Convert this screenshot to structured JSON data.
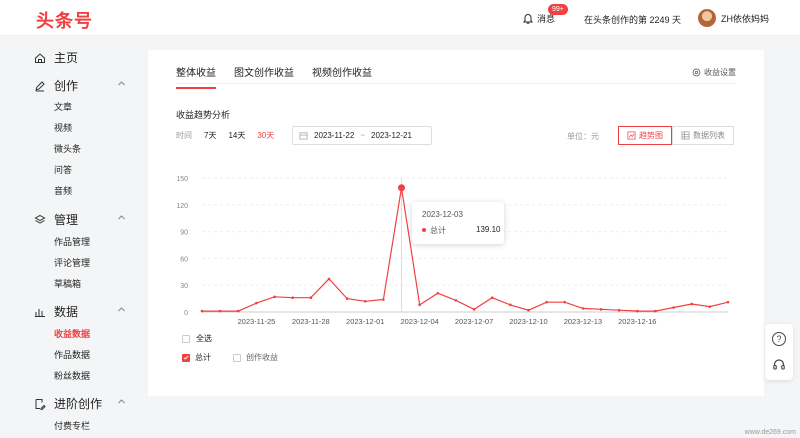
{
  "header": {
    "logo": "头条号",
    "messages_label": "消息",
    "messages_badge": "99+",
    "days_text": "在头条创作的第 2249 天",
    "username": "ZH依依妈妈"
  },
  "sidebar": {
    "home": "主页",
    "create": {
      "label": "创作",
      "items": [
        "文章",
        "视频",
        "微头条",
        "问答",
        "音频"
      ]
    },
    "manage": {
      "label": "管理",
      "items": [
        "作品管理",
        "评论管理",
        "草稿箱"
      ]
    },
    "data": {
      "label": "数据",
      "items": [
        "收益数据",
        "作品数据",
        "粉丝数据"
      ]
    },
    "advanced": {
      "label": "进阶创作",
      "items": [
        "付费专栏"
      ]
    }
  },
  "main": {
    "tabs": [
      "整体收益",
      "图文创作收益",
      "视频创作收益"
    ],
    "settings_label": "收益设置",
    "section_title": "收益趋势分析",
    "filter_label": "时间",
    "ranges": [
      "7天",
      "14天",
      "30天"
    ],
    "date_start": "2023-11-22",
    "date_sep": "~",
    "date_end": "2023-12-21",
    "unit": "单位：元",
    "view_trend": "趋势图",
    "view_table": "数据列表",
    "tooltip": {
      "date": "2023-12-03",
      "series": "总计",
      "value": "139.10"
    },
    "select_all": "全选",
    "legend_total": "总计",
    "legend_creation": "创作收益"
  },
  "floating": {
    "help": "?"
  },
  "watermark": "www.de269.com",
  "colors": {
    "accent": "#f04142"
  },
  "chart_data": {
    "type": "line",
    "x": [
      "2023-11-22",
      "2023-11-23",
      "2023-11-24",
      "2023-11-25",
      "2023-11-26",
      "2023-11-27",
      "2023-11-28",
      "2023-11-29",
      "2023-11-30",
      "2023-12-01",
      "2023-12-02",
      "2023-12-03",
      "2023-12-04",
      "2023-12-05",
      "2023-12-06",
      "2023-12-07",
      "2023-12-08",
      "2023-12-09",
      "2023-12-10",
      "2023-12-11",
      "2023-12-12",
      "2023-12-13",
      "2023-12-14",
      "2023-12-15",
      "2023-12-16",
      "2023-12-17",
      "2023-12-18",
      "2023-12-19",
      "2023-12-20",
      "2023-12-21"
    ],
    "xticks": [
      "2023-11-25",
      "2023-11-28",
      "2023-12-01",
      "2023-12-04",
      "2023-12-07",
      "2023-12-10",
      "2023-12-13",
      "2023-12-16"
    ],
    "yticks": [
      0,
      30,
      60,
      90,
      120,
      150
    ],
    "ylim": [
      0,
      150
    ],
    "series": [
      {
        "name": "总计",
        "values": [
          1,
          1,
          1,
          10,
          17,
          16,
          16,
          37,
          15,
          12,
          14,
          139.1,
          8,
          21,
          13,
          3,
          16,
          8,
          2,
          11,
          11,
          4,
          3,
          2,
          1,
          1,
          5,
          9,
          6,
          11
        ]
      }
    ]
  }
}
